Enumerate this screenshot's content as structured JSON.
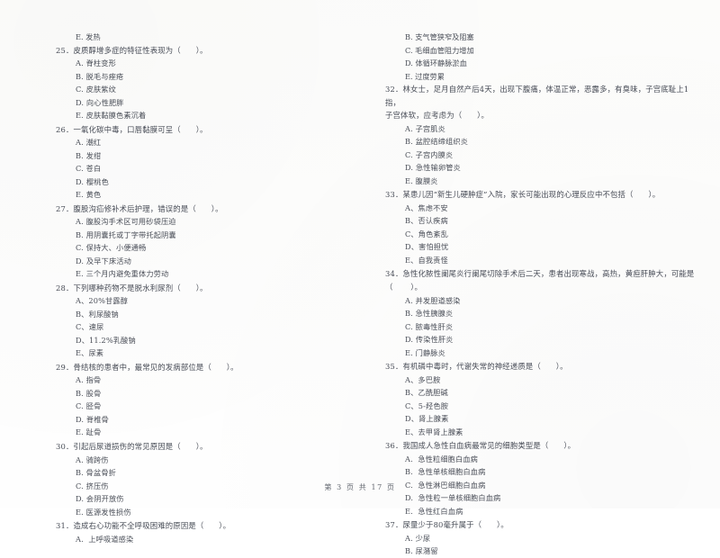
{
  "document": {
    "footer": "第 3 页  共 17 页"
  },
  "left_column": {
    "lead_option": "E. 发热",
    "questions": [
      {
        "number": "25",
        "text": "25．皮质醇增多症的特征性表现为（      ）。",
        "options": [
          "A. 脊柱变形",
          "B. 脱毛与痤疮",
          "C. 皮肤紫纹",
          "D. 向心性肥胖",
          "E. 皮肤黏膜色素沉着"
        ]
      },
      {
        "number": "26",
        "text": "26．一氧化碳中毒，口唇黏膜可呈（      ）。",
        "options": [
          "A. 潮红",
          "B. 发绀",
          "C. 苍白",
          "D. 樱桃色",
          "E. 黄色"
        ]
      },
      {
        "number": "27",
        "text": "27．腹股沟疝修补术后护理，错误的是（      ）。",
        "options": [
          "A. 腹股沟手术区可用砂袋压迫",
          "B. 用阴囊托或丁字带托起阴囊",
          "C. 保持大、小便通畅",
          "D. 及早下床活动",
          "E. 三个月内避免重体力劳动"
        ]
      },
      {
        "number": "28",
        "text": "28．下列哪种药物不是脱水利尿剂（      ）。",
        "options": [
          "A、20%甘露醇",
          "B、利尿酸钠",
          "C、速尿",
          "D、11.2%乳酸钠",
          "E、尿素"
        ]
      },
      {
        "number": "29",
        "text": "29．骨结核的患者中，最常见的发病部位是（      ）。",
        "options": [
          "A. 指骨",
          "B. 股骨",
          "C. 胫骨",
          "D. 脊椎骨",
          "E. 趾骨"
        ]
      },
      {
        "number": "30",
        "text": "30．引起后尿道损伤的常见原因是（      ）。",
        "options": [
          "A. 骑跨伤",
          "B. 骨盆骨折",
          "C. 挤压伤",
          "D. 会阴开放伤",
          "E. 医源发性损伤"
        ]
      },
      {
        "number": "31",
        "text": "31．造成右心功能不全呼吸困难的原因是（      ）。",
        "options": [
          "A.  上呼吸道感染"
        ]
      }
    ]
  },
  "right_column": {
    "lead_options": [
      "B.  支气管狭窄及阻塞",
      "C.  毛细血管阻力增加",
      "D.  体循环静脉淤血",
      "E.  过度劳累"
    ],
    "questions": [
      {
        "number": "32",
        "text": "32．林女士，足月自然产后4天，出现下腹痛，体温正常，恶露多，有臭味，子宫底耻上1指，",
        "text_cont": "子宫体软，应考虑为（      ）。",
        "options": [
          "A. 子宫肌炎",
          "B. 盆腔结缔组织炎",
          "C. 子宫内膜炎",
          "D. 急性输卵管炎",
          "E. 腹膜炎"
        ]
      },
      {
        "number": "33",
        "text": "33．某患儿因“新生儿硬肿症”入院，家长可能出现的心理反应中不包括（      ）。",
        "options": [
          "A、焦虑不安",
          "B、否认疾病",
          "C、角色紊乱",
          "D、害怕担忧",
          "E、自我责怪"
        ]
      },
      {
        "number": "34",
        "text": "34．急性化脓性阑尾炎行阑尾切除手术后二天，患者出现寒战，高热，黄疸肝肿大，可能是（       ）。",
        "options": [
          "A. 并发胆道感染",
          "B. 急性胰腺炎",
          "C. 脓毒性肝炎",
          "D. 传染性肝炎",
          "E. 门静脉炎"
        ]
      },
      {
        "number": "35",
        "text": "35．有机磷中毒时，代谢失常的神经递质是（      ）。",
        "options": [
          "A、多巴胺",
          "B、乙酰胆碱",
          "C、5-羟色胺",
          "D、肾上腺素",
          "E、去甲肾上腺素"
        ]
      },
      {
        "number": "36",
        "text": "36．我国成人急性白血病最常见的细胞类型是（      ）。",
        "options": [
          "A.  急性粒细胞白血病",
          "B.  急性单核细胞白血病",
          "C.  急性淋巴细胞白血病",
          "D.  急性粒一单核细胞白血病",
          "E.  急性红白血病"
        ]
      },
      {
        "number": "37",
        "text": "37．尿量少于80毫升属于（      ）。",
        "options": [
          "A. 少尿",
          "B. 尿潴留"
        ]
      }
    ]
  }
}
